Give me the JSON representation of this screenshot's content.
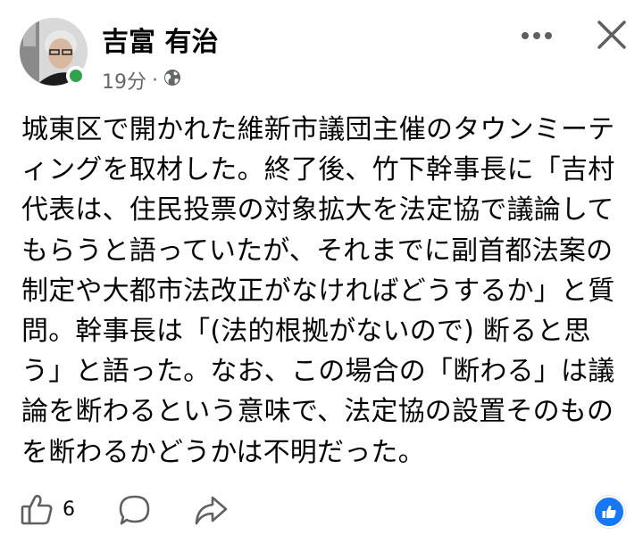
{
  "author": {
    "name": "吉富 有治",
    "online_color": "#31a24c"
  },
  "meta": {
    "timestamp": "19分",
    "separator": "·",
    "audience_icon": "globe-icon"
  },
  "header_actions": {
    "more_icon": "more-horizontal-icon",
    "close_icon": "close-icon"
  },
  "post": {
    "lines": [
      "城東区で開かれた維新市議団主催のタウンミーテ",
      "ィングを取材した。終了後、竹下幹事長に「吉村",
      "代表は、住民投票の対象拡大を法定協で議論して",
      "もらうと語っていたが、それまでに副首都法案の",
      "制定や大都市法改正がなければどうするか」と質",
      "問。幹事長は「(法的根拠がないので) 断ると思",
      "う」と語った。なお、この場合の「断わる」は議",
      "論を断わるという意味で、法定協の設置そのもの",
      "を断わるかどうかは不明だった。"
    ]
  },
  "actions": {
    "like_icon": "thumbs-up-icon",
    "like_count": "6",
    "comment_icon": "comment-icon",
    "share_icon": "share-icon",
    "reaction_icon": "like-reaction-icon",
    "reaction_color": "#1877f2"
  }
}
